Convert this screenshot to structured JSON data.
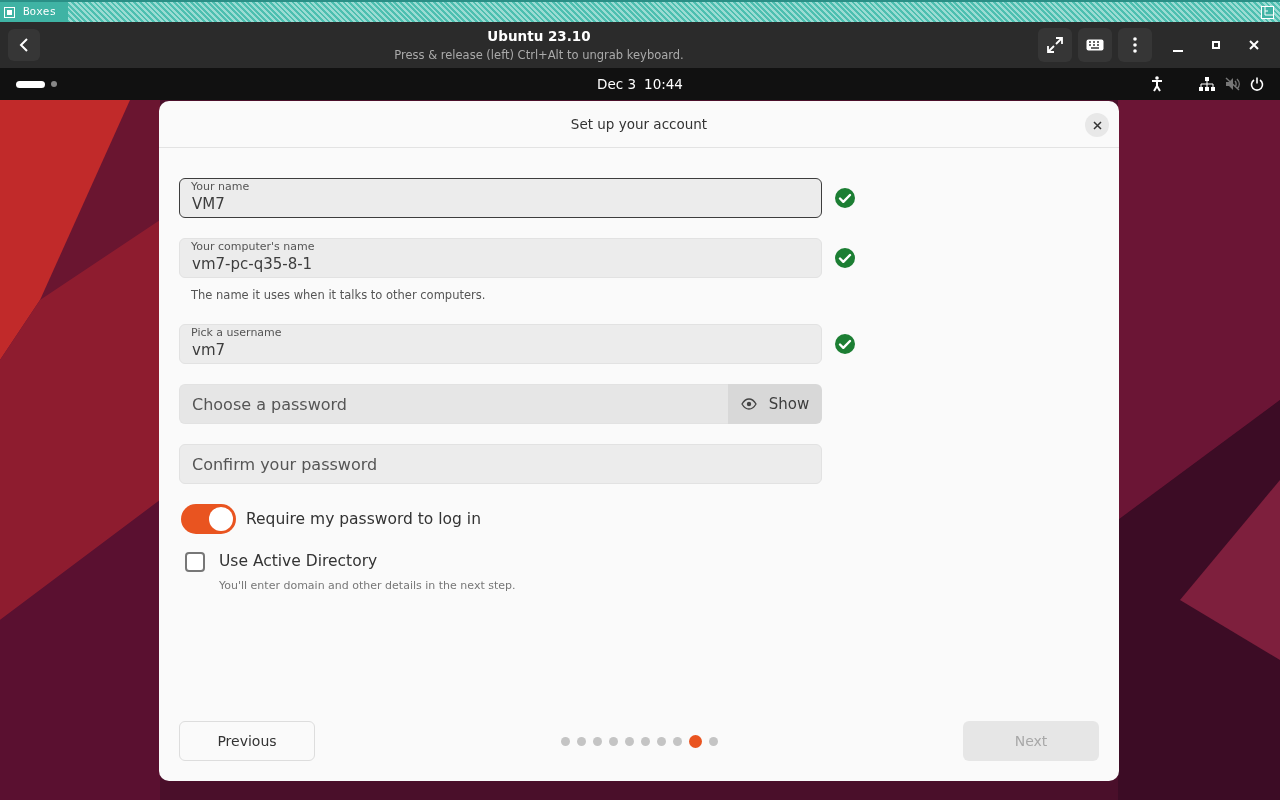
{
  "host_title_bar": {
    "title": "Boxes"
  },
  "header": {
    "title": "Ubuntu 23.10",
    "subtitle": "Press & release (left) Ctrl+Alt to ungrab keyboard."
  },
  "top_panel": {
    "clock_date": "Dec 3",
    "clock_time": "10:44",
    "workspaces": [
      {
        "selected": true
      },
      {
        "selected": false
      }
    ]
  },
  "dialog": {
    "title": "Set up your account",
    "fields": [
      {
        "kind": "text",
        "label": "Your name",
        "value": "VM7",
        "focused": true,
        "valid": true
      },
      {
        "kind": "text",
        "label": "Your computer's name",
        "value": "vm7-pc-q35-8-1",
        "focused": false,
        "valid": true,
        "hint": "The name it uses when it talks to other computers."
      },
      {
        "kind": "text",
        "label": "Pick a username",
        "value": "vm7",
        "focused": false,
        "valid": true
      },
      {
        "kind": "password",
        "placeholder": "Choose a password",
        "button": "Show",
        "focused": false,
        "valid": false
      },
      {
        "kind": "placeholder",
        "placeholder": "Confirm your password",
        "focused": false,
        "valid": false
      }
    ],
    "require_password": {
      "label": "Require my password to log in",
      "on": true
    },
    "active_directory": {
      "label": "Use Active Directory",
      "checked": false,
      "hint": "You'll enter domain and other details in the next step."
    },
    "previous_button": "Previous",
    "next_button": {
      "label": "Next",
      "disabled": true
    },
    "pages": [
      {
        "selected": false
      },
      {
        "selected": false
      },
      {
        "selected": false
      },
      {
        "selected": false
      },
      {
        "selected": false
      },
      {
        "selected": false
      },
      {
        "selected": false
      },
      {
        "selected": false
      },
      {
        "selected": true
      },
      {
        "selected": false
      }
    ]
  }
}
